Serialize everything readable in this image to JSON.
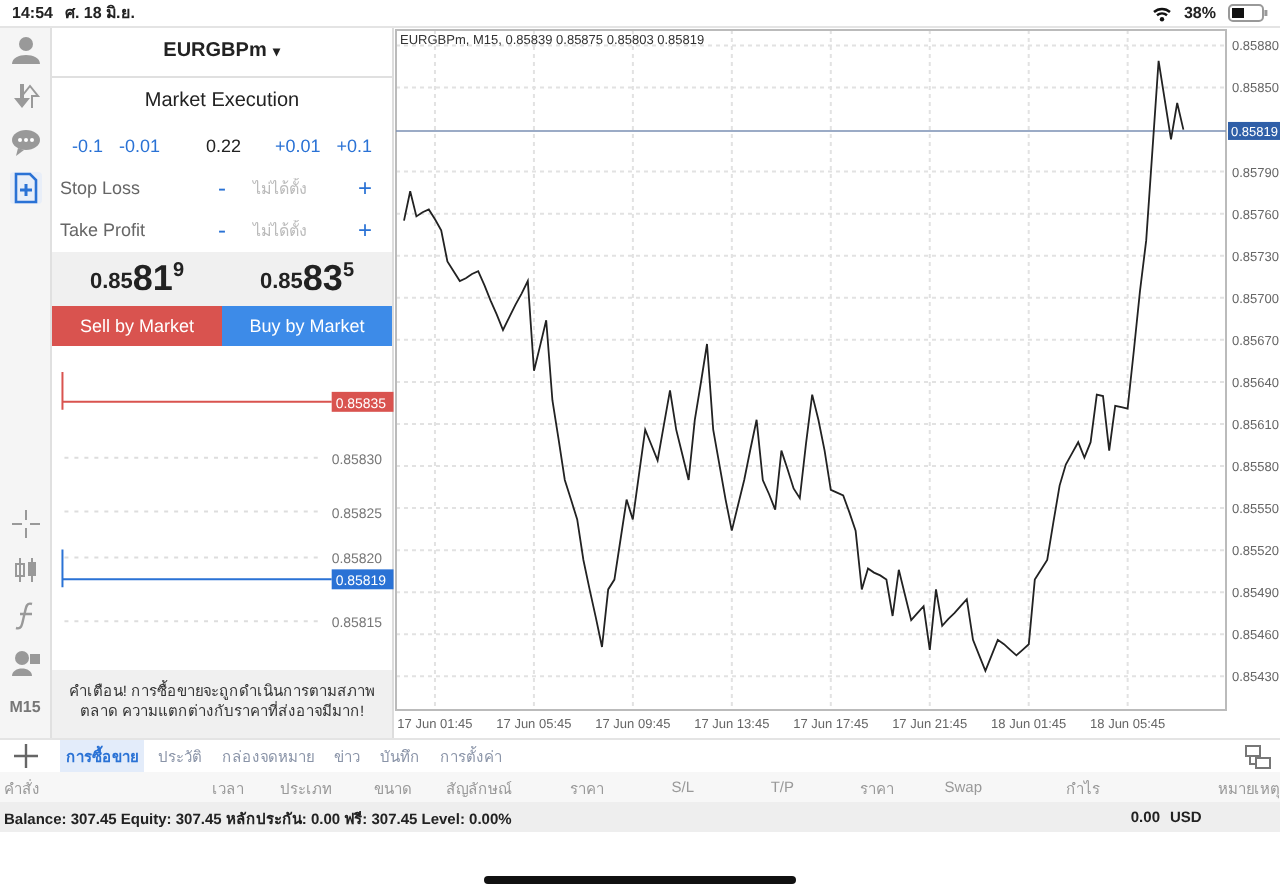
{
  "status_bar": {
    "time": "14:54",
    "date": "ศ. 18 มิ.ย.",
    "battery": "38%"
  },
  "left_toolbar": {
    "top_icons": [
      {
        "kind": "account",
        "selected": false
      },
      {
        "kind": "trade",
        "selected": false
      },
      {
        "kind": "chat",
        "selected": false
      },
      {
        "kind": "new-order",
        "selected": true
      }
    ],
    "bottom_icons": [
      {
        "kind": "crosshair"
      },
      {
        "kind": "candles"
      },
      {
        "kind": "function"
      },
      {
        "kind": "objects"
      }
    ],
    "timeframe": "M15"
  },
  "order_panel": {
    "symbol": "EURGBPm",
    "symbol_caret": "▾",
    "execution": "Market Execution",
    "volume": {
      "steps_down": [
        "-0.1",
        "-0.01"
      ],
      "value": "0.22",
      "steps_up": [
        "+0.01",
        "+0.1"
      ]
    },
    "stops": [
      {
        "label": "Stop Loss",
        "minus": "-",
        "placeholder": "ไม่ได้ตั้ง",
        "plus": "+"
      },
      {
        "label": "Take Profit",
        "minus": "-",
        "placeholder": "ไม่ได้ตั้ง",
        "plus": "+"
      }
    ],
    "prices": [
      {
        "lead": "0.85",
        "pips": "81",
        "point": "9"
      },
      {
        "lead": "0.85",
        "pips": "83",
        "point": "5"
      }
    ],
    "buttons": [
      {
        "label": "Sell by Market",
        "kind": "sell"
      },
      {
        "label": "Buy by Market",
        "kind": "buy"
      }
    ],
    "price_levels": [
      {
        "label": "0.85835",
        "kind": "ask"
      },
      {
        "label": "0.85830",
        "kind": "tick"
      },
      {
        "label": "0.85825",
        "kind": "tick"
      },
      {
        "label": "0.85820",
        "kind": "tick"
      },
      {
        "label": "0.85819",
        "kind": "bid"
      },
      {
        "label": "0.85815",
        "kind": "tick"
      }
    ],
    "warning": "คำเตือน! การซื้อขายจะถูกดำเนินการตามสภาพตลาด ความแตกต่างกับราคาที่ส่งอาจมีมาก!"
  },
  "chart": {
    "chart_data": {
      "type": "line",
      "title": "EURGBPm, M15, 0.85839 0.85875 0.85803 0.85819",
      "categories": [
        null,
        null,
        null,
        null,
        null,
        "17 Jun 01:45",
        null,
        null,
        null,
        null,
        null,
        null,
        null,
        null,
        null,
        null,
        null,
        null,
        null,
        null,
        null,
        "17 Jun 05:45",
        null,
        null,
        null,
        null,
        null,
        null,
        null,
        null,
        null,
        null,
        null,
        null,
        null,
        null,
        null,
        "17 Jun 09:45",
        null,
        null,
        null,
        null,
        null,
        null,
        null,
        null,
        null,
        null,
        null,
        null,
        null,
        null,
        null,
        "17 Jun 13:45",
        null,
        null,
        null,
        null,
        null,
        null,
        null,
        null,
        null,
        null,
        null,
        null,
        null,
        null,
        null,
        "17 Jun 17:45",
        null,
        null,
        null,
        null,
        null,
        null,
        null,
        null,
        null,
        null,
        null,
        null,
        null,
        null,
        null,
        "17 Jun 21:45",
        null,
        null,
        null,
        null,
        null,
        null,
        null,
        null,
        null,
        null,
        null,
        null,
        null,
        null,
        null,
        "18 Jun 01:45",
        null,
        null,
        null,
        null,
        null,
        null,
        null,
        null,
        null,
        null,
        null,
        null,
        null,
        null,
        null,
        "18 Jun 05:45",
        null,
        null,
        null,
        null,
        null,
        null,
        null,
        null,
        null
      ],
      "series": [
        {
          "color": "#222222",
          "values": [
            0.85755,
            0.85776,
            0.85758,
            0.85761,
            0.85763,
            0.85756,
            0.85748,
            0.85726,
            0.85719,
            0.85712,
            0.85714,
            0.85717,
            0.85719,
            0.85709,
            0.85698,
            0.85688,
            0.85677,
            0.85686,
            0.85695,
            0.85703,
            0.85712,
            0.85648,
            0.85666,
            0.85684,
            0.85627,
            0.85599,
            0.8557,
            0.85556,
            0.85542,
            0.85513,
            0.85492,
            0.85472,
            0.85451,
            0.85492,
            0.85499,
            0.85528,
            0.85556,
            0.85542,
            0.85574,
            0.85606,
            0.85595,
            0.85584,
            0.85609,
            0.85634,
            0.85606,
            0.85588,
            0.8557,
            0.85613,
            0.8564,
            0.85667,
            0.85606,
            0.85581,
            0.85556,
            0.85534,
            0.85552,
            0.8557,
            0.85592,
            0.85613,
            0.8557,
            0.8556,
            0.85549,
            0.85591,
            0.85578,
            0.85564,
            0.85557,
            0.85596,
            0.85631,
            0.85613,
            0.85591,
            0.85563,
            0.85561,
            0.85559,
            0.85547,
            0.85534,
            0.85492,
            0.85507,
            0.85504,
            0.85502,
            0.85499,
            0.85473,
            0.85506,
            0.85488,
            0.8547,
            0.85475,
            0.8548,
            0.85449,
            0.85492,
            0.85466,
            0.85471,
            0.85475,
            0.8548,
            0.85485,
            0.85456,
            0.85445,
            0.85434,
            0.85445,
            0.85456,
            0.85453,
            0.85449,
            0.85445,
            0.85449,
            0.85453,
            0.85499,
            0.85506,
            0.85513,
            0.8554,
            0.85566,
            0.85581,
            0.85589,
            0.85597,
            0.85586,
            0.85597,
            0.85631,
            0.8563,
            0.85591,
            0.85623,
            0.85622,
            0.85621,
            0.85662,
            0.85705,
            0.85741,
            0.85805,
            0.85869,
            0.85841,
            0.85813,
            0.85839,
            0.8582
          ]
        }
      ],
      "ylim": [
        0.85406,
        0.85891
      ],
      "yticks": [
        {
          "value": 0.8588,
          "label": "0.85880"
        },
        {
          "value": 0.8585,
          "label": "0.85850"
        },
        {
          "value": 0.8579,
          "label": "0.85790"
        },
        {
          "value": 0.8576,
          "label": "0.85760"
        },
        {
          "value": 0.8573,
          "label": "0.85730"
        },
        {
          "value": 0.857,
          "label": "0.85700"
        },
        {
          "value": 0.8567,
          "label": "0.85670"
        },
        {
          "value": 0.8564,
          "label": "0.85640"
        },
        {
          "value": 0.8561,
          "label": "0.85610"
        },
        {
          "value": 0.8558,
          "label": "0.85580"
        },
        {
          "value": 0.8555,
          "label": "0.85550"
        },
        {
          "value": 0.8552,
          "label": "0.85520"
        },
        {
          "value": 0.8549,
          "label": "0.85490"
        },
        {
          "value": 0.8546,
          "label": "0.85460"
        },
        {
          "value": 0.8543,
          "label": "0.85430"
        }
      ],
      "grid": true,
      "ref_lines": [
        {
          "axis": "y",
          "value": 0.85819,
          "label": "0.85819",
          "color": "#7a8fb3"
        }
      ]
    }
  },
  "bottom_tabs": [
    {
      "label": "การซื้อขาย",
      "selected": true
    },
    {
      "label": "ประวัติ",
      "selected": false
    },
    {
      "label": "กล่องจดหมาย",
      "selected": false
    },
    {
      "label": "ข่าว",
      "selected": false
    },
    {
      "label": "บันทึก",
      "selected": false
    },
    {
      "label": "การตั้งค่า",
      "selected": false
    }
  ],
  "table": {
    "columns": [
      "คำสั่ง",
      "เวลา",
      "ประเภท",
      "ขนาด",
      "สัญลักษณ์",
      "ราคา",
      "S/L",
      "T/P",
      "ราคา",
      "Swap",
      "กำไร",
      "หมายเหตุ"
    ],
    "summary": "Balance: 307.45 Equity: 307.45 หลักประกัน: 0.00 ฟรี: 307.45 Level: 0.00%",
    "profit": "0.00",
    "currency": "USD"
  }
}
